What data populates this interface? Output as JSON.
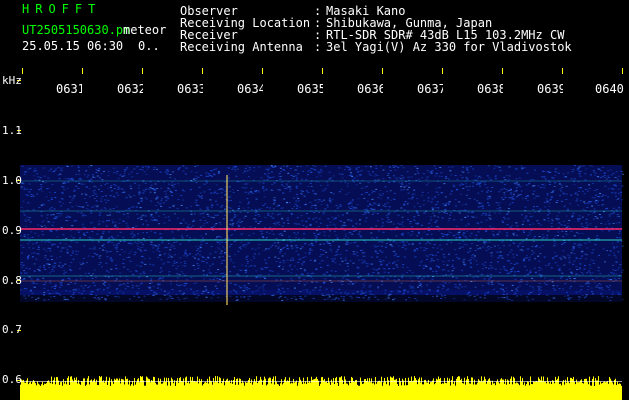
{
  "header": {
    "app_title": "HROFFT",
    "file_name": "UT2505150630.pn",
    "meteor_label": "meteor",
    "date_time": "25.05.15 06:30",
    "status": "0..",
    "info_rows": [
      {
        "label": "Observer",
        "sep": ":",
        "value": "Masaki Kano"
      },
      {
        "label": "Receiving Location",
        "sep": ":",
        "value": "Shibukawa, Gunma, Japan"
      },
      {
        "label": "Receiver",
        "sep": ":",
        "value": "RTL-SDR SDR# 43dB L15 103.2MHz CW"
      },
      {
        "label": "Receiving Antenna",
        "sep": ":",
        "value": "3el Yagi(V) Az 330 for Vladivostok"
      }
    ]
  },
  "axes": {
    "freq_unit": "kHz",
    "freq_ticks": [
      "1.1",
      "1.0",
      "0.9",
      "0.8",
      "0.7",
      "0.6"
    ],
    "time_ticks": [
      "0631",
      "0632",
      "0633",
      "0634",
      "0635",
      "0636",
      "0637",
      "0638",
      "0639",
      "0640"
    ]
  },
  "colors": {
    "background": "#000000",
    "header_green": "#00ff00",
    "text_white": "#ffffff",
    "noise_dark": "#0a1a9a",
    "noise_light": "#4a8cff",
    "echo_line": "#ff2a6a",
    "tick_mark": "#ffff00",
    "power_band": "#ffff00"
  }
}
